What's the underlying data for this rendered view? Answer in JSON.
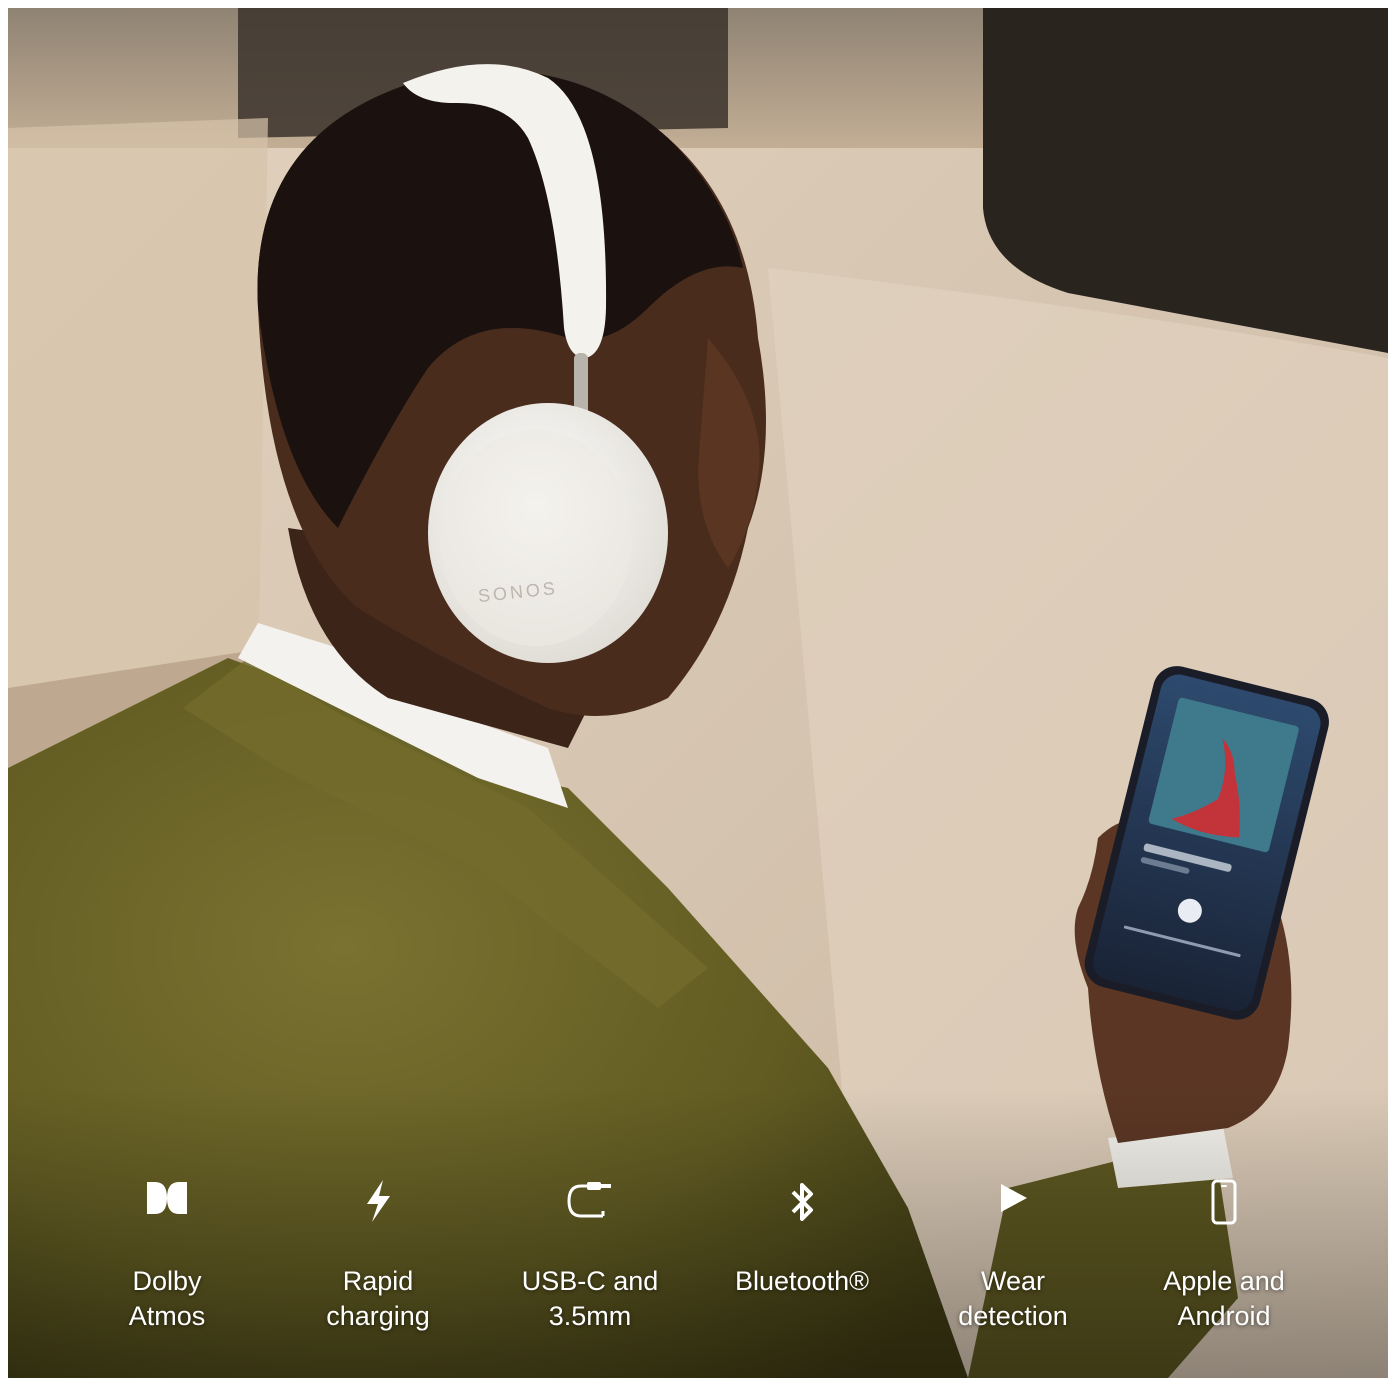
{
  "image": {
    "subject": "Man wearing white Sonos over-ear headphones looking at a phone",
    "headphone_brand_mark": "SONOS"
  },
  "features": [
    {
      "icon": "dolby-atmos-icon",
      "label": "Dolby\nAtmos"
    },
    {
      "icon": "lightning-bolt-icon",
      "label": "Rapid\ncharging"
    },
    {
      "icon": "usb-c-cable-icon",
      "label": "USB-C and\n3.5mm"
    },
    {
      "icon": "bluetooth-icon",
      "label": "Bluetooth®"
    },
    {
      "icon": "play-triangle-icon",
      "label": "Wear\ndetection"
    },
    {
      "icon": "smartphone-icon",
      "label": "Apple and\nAndroid"
    }
  ],
  "colors": {
    "jacket": "#6b6526",
    "headphones": "#f1efea",
    "background": "#cdb9a0",
    "text": "#ffffff"
  }
}
